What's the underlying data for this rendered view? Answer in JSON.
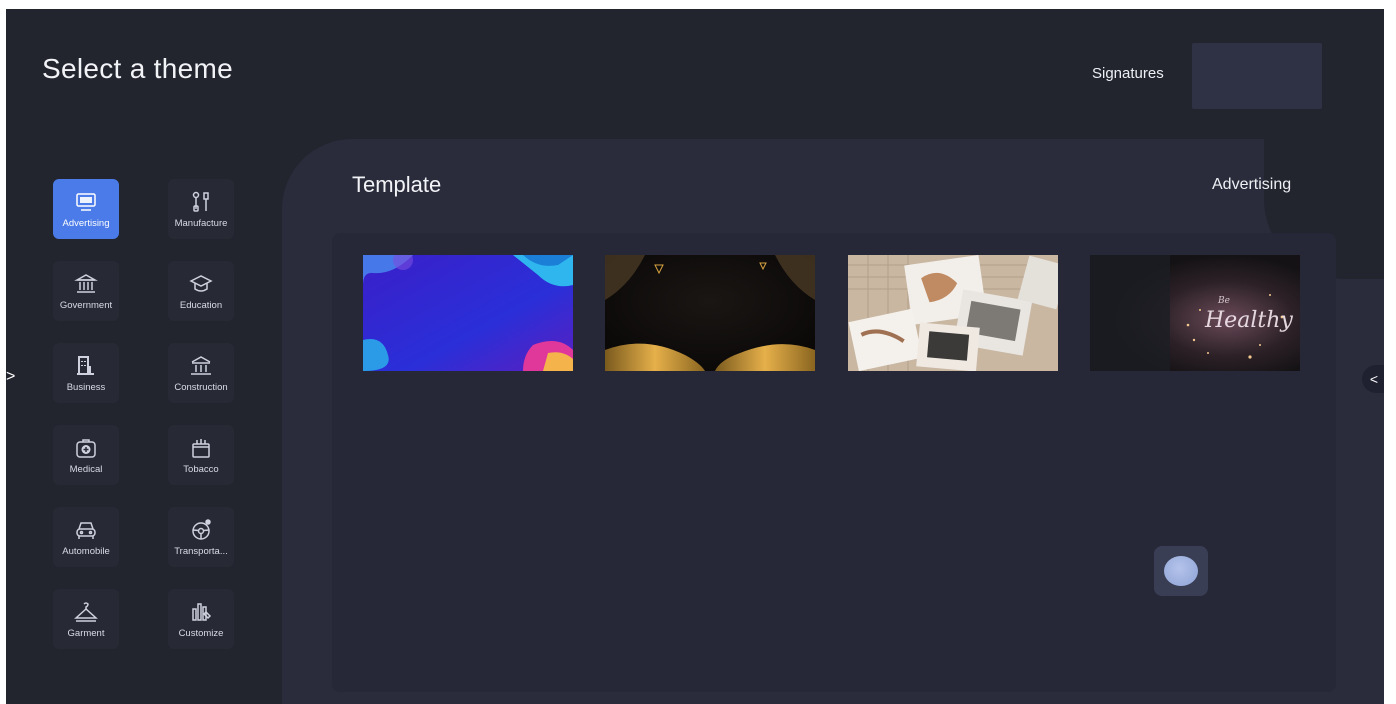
{
  "header": {
    "title": "Select a theme",
    "signatures_label": "Signatures"
  },
  "categories": [
    {
      "label": "Advertising",
      "icon": "monitor-icon",
      "active": true
    },
    {
      "label": "Manufacture",
      "icon": "tools-icon",
      "active": false
    },
    {
      "label": "Government",
      "icon": "government-building-icon",
      "active": false
    },
    {
      "label": "Education",
      "icon": "graduation-cap-icon",
      "active": false
    },
    {
      "label": "Business",
      "icon": "office-building-icon",
      "active": false
    },
    {
      "label": "Construction",
      "icon": "columns-building-icon",
      "active": false
    },
    {
      "label": "Medical",
      "icon": "first-aid-kit-icon",
      "active": false
    },
    {
      "label": "Tobacco",
      "icon": "cigarette-box-icon",
      "active": false
    },
    {
      "label": "Automobile",
      "icon": "car-icon",
      "active": false
    },
    {
      "label": "Transporta...",
      "icon": "steering-wheel-icon",
      "active": false
    },
    {
      "label": "Garment",
      "icon": "hanger-icon",
      "active": false
    },
    {
      "label": "Customize",
      "icon": "customize-bars-icon",
      "active": false
    }
  ],
  "main": {
    "template_title": "Template",
    "current_category": "Advertising",
    "templates": [
      {
        "name": "blue-abstract-template"
      },
      {
        "name": "gold-black-template"
      },
      {
        "name": "photo-collage-template"
      },
      {
        "name": "healthy-neon-template"
      }
    ]
  },
  "nav": {
    "left_arrow": ">",
    "right_arrow": "<"
  },
  "colors": {
    "accent": "#4a7be8",
    "background": "#22242e",
    "panel": "#2a2c3b"
  }
}
